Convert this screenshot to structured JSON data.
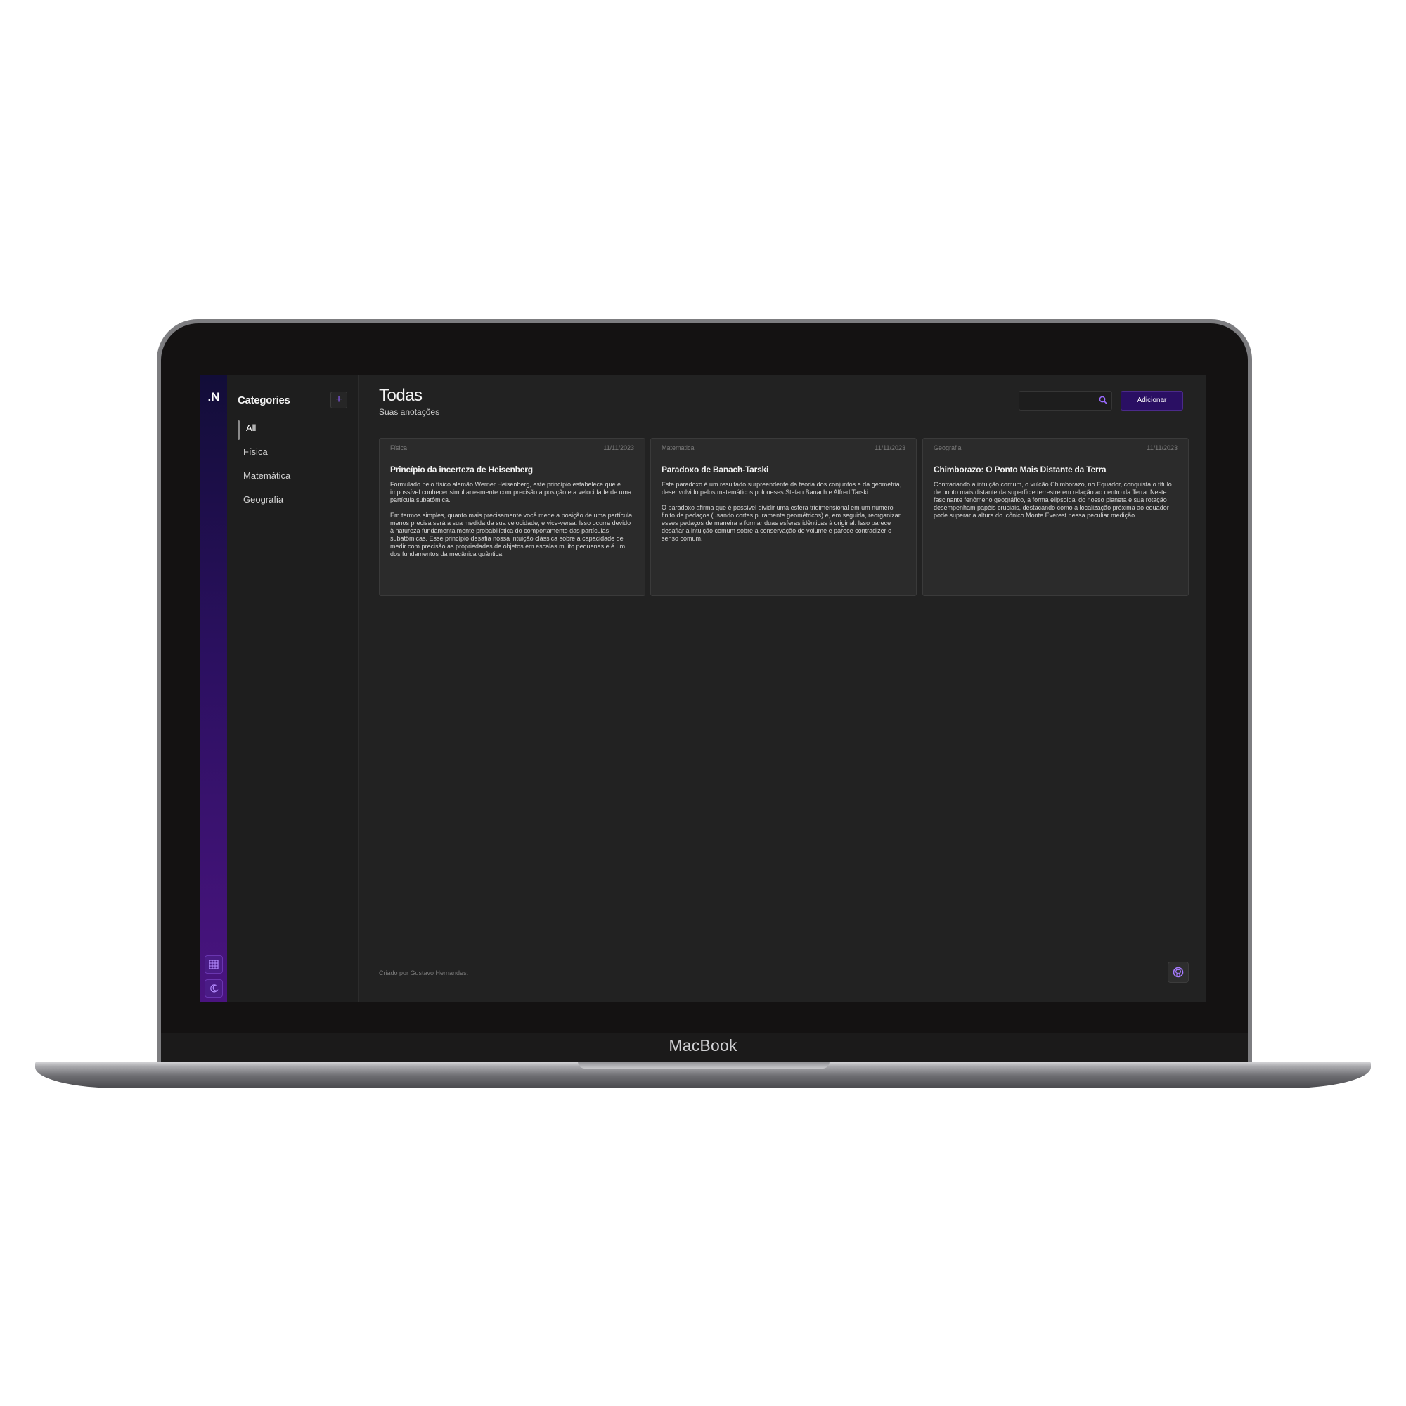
{
  "device": {
    "brand_label": "MacBook"
  },
  "app": {
    "logo": ".N",
    "rail": {
      "grid_icon": "grid-icon",
      "theme_icon": "moon-icon"
    }
  },
  "sidebar": {
    "title": "Categories",
    "add_label": "+",
    "items": [
      {
        "label": "All",
        "active": true
      },
      {
        "label": "Física"
      },
      {
        "label": "Matemática"
      },
      {
        "label": "Geografia"
      }
    ]
  },
  "header": {
    "title": "Todas",
    "subtitle": "Suas anotações",
    "search": {
      "value": "",
      "placeholder": ""
    },
    "add_button": "Adicionar"
  },
  "notes": [
    {
      "category": "Física",
      "date": "11/11/2023",
      "title": "Princípio da incerteza de Heisenberg",
      "paragraphs": [
        "Formulado pelo físico alemão Werner Heisenberg, este princípio estabelece que é impossível conhecer simultaneamente com precisão a posição e a velocidade de uma partícula subatômica.",
        "Em termos simples, quanto mais precisamente você mede a posição de uma partícula, menos precisa será a sua medida da sua velocidade, e vice-versa. Isso ocorre devido à natureza fundamentalmente probabilística do comportamento das partículas subatômicas. Esse princípio desafia nossa intuição clássica sobre a capacidade de medir com precisão as propriedades de objetos em escalas muito pequenas e é um dos fundamentos da mecânica quântica."
      ]
    },
    {
      "category": "Matemática",
      "date": "11/11/2023",
      "title": "Paradoxo de Banach-Tarski",
      "paragraphs": [
        "Este paradoxo é um resultado surpreendente da teoria dos conjuntos e da geometria, desenvolvido pelos matemáticos poloneses Stefan Banach e Alfred Tarski.",
        "O paradoxo afirma que é possível dividir uma esfera tridimensional em um número finito de pedaços (usando cortes puramente geométricos) e, em seguida, reorganizar esses pedaços de maneira a formar duas esferas idênticas à original. Isso parece desafiar a intuição comum sobre a conservação de volume e parece contradizer o senso comum."
      ]
    },
    {
      "category": "Geografia",
      "date": "11/11/2023",
      "title": "Chimborazo: O Ponto Mais Distante da Terra",
      "paragraphs": [
        "Contrariando a intuição comum, o vulcão Chimborazo, no Equador, conquista o título de ponto mais distante da superfície terrestre em relação ao centro da Terra. Neste fascinante fenômeno geográfico, a forma elipsoidal do nosso planeta e sua rotação desempenham papéis cruciais, destacando como a localização próxima ao equador pode superar a altura do icônico Monte Everest nessa peculiar medição."
      ]
    }
  ],
  "footer": {
    "credit": "Criado por Gustavo Hernandes.",
    "icon": "github-icon"
  },
  "colors": {
    "accent": "#8b5cf6",
    "button_bg": "#2a0f63",
    "rail_top": "#120d38",
    "rail_bottom": "#4a1480",
    "background": "#222222",
    "card": "#2b2b2b"
  }
}
